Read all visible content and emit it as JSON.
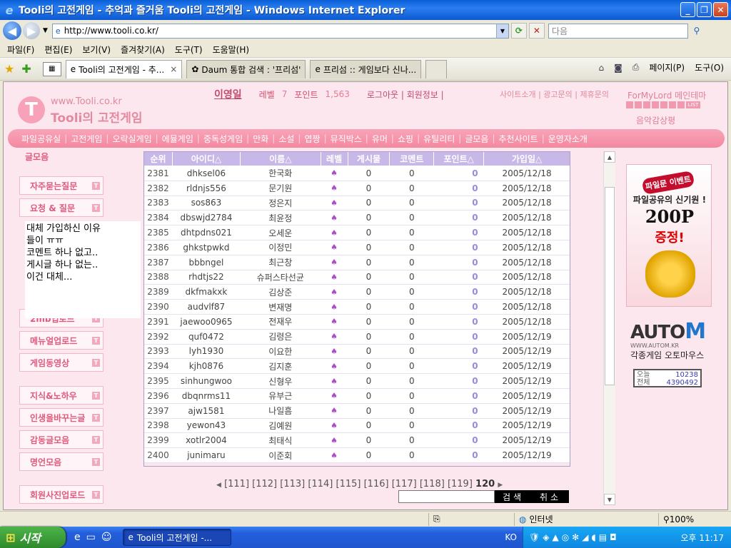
{
  "window": {
    "title": "Tooli의 고전게임 - 추억과 즐거움 Tooli의 고전게임 - Windows Internet Explorer"
  },
  "address": {
    "url": "http://www.tooli.co.kr/",
    "search_placeholder": "다음"
  },
  "menu": [
    "파일(F)",
    "편집(E)",
    "보기(V)",
    "즐겨찾기(A)",
    "도구(T)",
    "도움말(H)"
  ],
  "tabs": [
    {
      "label": "Tooli의 고전게임 - 추...",
      "close": "×"
    },
    {
      "label": "Daum 통합 검색 : '프리섬'"
    },
    {
      "label": "프리섬 :: 게임보다 신나..."
    }
  ],
  "commands": {
    "page": "페이지(P)",
    "tools": "도구(O)"
  },
  "site": {
    "logo_url": "www.Tooli.co.kr",
    "logo_name": "Tooli의 고전게임",
    "user": {
      "name": "이영일",
      "level_label": "레벨",
      "level": "7",
      "point_label": "포인트",
      "points": "1,563",
      "links": "로그아웃 | 회원정보 |"
    },
    "top_links": "사이트소개 | 광고문의 | 제휴문의",
    "theme": "ForMyLord 메인테마",
    "theme_list": "LIST",
    "music": "음악감상평",
    "nav": [
      "파일공유실",
      "고전게임",
      "오락실게임",
      "에뮬게임",
      "중독성게임",
      "만화",
      "소설",
      "엽짱",
      "뮤직박스",
      "유머",
      "쇼핑",
      "유틸리티",
      "글모음",
      "추천사이트",
      "운영자소개"
    ],
    "left_head": "글모음",
    "left_menu": [
      "자주묻는질문",
      "요청 & 질문",
      "2mb업로드",
      "메뉴얼업로드",
      "게임동영상",
      "지식&노하우",
      "인생을바꾸는글",
      "감동글모음",
      "명언모음",
      "회원사진업로드"
    ],
    "note": [
      "대체 가입하신 이유",
      "들이 ㅠㅠ",
      "코멘트 하나 없고..",
      "게시글 하나 없는..",
      "이건 대체..."
    ],
    "table": {
      "headers": [
        "순위",
        "아이디△",
        "이름△",
        "레벨",
        "게시물",
        "코멘트",
        "포인트△",
        "가입일△"
      ],
      "rows": [
        [
          "2381",
          "dhksel06",
          "한국화",
          "0",
          "0",
          "0",
          "2005/12/18"
        ],
        [
          "2382",
          "rldnjs556",
          "문기원",
          "0",
          "0",
          "0",
          "2005/12/18"
        ],
        [
          "2383",
          "sos863",
          "정은지",
          "0",
          "0",
          "0",
          "2005/12/18"
        ],
        [
          "2384",
          "dbswjd2784",
          "최윤정",
          "0",
          "0",
          "0",
          "2005/12/18"
        ],
        [
          "2385",
          "dhtpdns021",
          "오세운",
          "0",
          "0",
          "0",
          "2005/12/18"
        ],
        [
          "2386",
          "ghkstpwkd",
          "이정민",
          "0",
          "0",
          "0",
          "2005/12/18"
        ],
        [
          "2387",
          "bbbngel",
          "최근창",
          "0",
          "0",
          "0",
          "2005/12/18"
        ],
        [
          "2388",
          "rhdtjs22",
          "슈퍼스타선균",
          "0",
          "0",
          "0",
          "2005/12/18"
        ],
        [
          "2389",
          "dkfmakxk",
          "김상준",
          "0",
          "0",
          "0",
          "2005/12/18"
        ],
        [
          "2390",
          "audvlf87",
          "변재명",
          "0",
          "0",
          "0",
          "2005/12/18"
        ],
        [
          "2391",
          "jaewoo0965",
          "전재우",
          "0",
          "0",
          "0",
          "2005/12/18"
        ],
        [
          "2392",
          "quf0472",
          "김령은",
          "0",
          "0",
          "0",
          "2005/12/19"
        ],
        [
          "2393",
          "lyh1930",
          "이요한",
          "0",
          "0",
          "0",
          "2005/12/19"
        ],
        [
          "2394",
          "kjh0876",
          "김지훈",
          "0",
          "0",
          "0",
          "2005/12/19"
        ],
        [
          "2395",
          "sinhungwoo",
          "신형우",
          "0",
          "0",
          "0",
          "2005/12/19"
        ],
        [
          "2396",
          "dbqnrms11",
          "유부근",
          "0",
          "0",
          "0",
          "2005/12/19"
        ],
        [
          "2397",
          "ajw1581",
          "나일흠",
          "0",
          "0",
          "0",
          "2005/12/19"
        ],
        [
          "2398",
          "yewon43",
          "김예원",
          "0",
          "0",
          "0",
          "2005/12/19"
        ],
        [
          "2399",
          "xotlr2004",
          "최태식",
          "0",
          "0",
          "0",
          "2005/12/19"
        ],
        [
          "2400",
          "junimaru",
          "이준회",
          "0",
          "0",
          "0",
          "2005/12/19"
        ]
      ]
    },
    "pager": {
      "pages": [
        "[111]",
        "[112]",
        "[113]",
        "[114]",
        "[115]",
        "[116]",
        "[117]",
        "[118]",
        "[119]"
      ],
      "current": "120"
    },
    "search_btn": "검색",
    "cancel_btn": "취소",
    "banner": {
      "tag": "파일문 이벤트",
      "line1": "파일공유의 신기원 !",
      "big": "200P",
      "sub": "증정!"
    },
    "autom": {
      "brand": "AUTO",
      "brand_m": "M",
      "www": "WWW.AUTOM.KR",
      "desc": "각종게임 오토마우스"
    },
    "counter": {
      "today_label": "오늘",
      "today": "10238",
      "total_label": "전체",
      "total": "4390492"
    }
  },
  "status": {
    "zone": "인터넷",
    "zoom": "100%"
  },
  "taskbar": {
    "start": "시작",
    "task": "Tooli의 고전게임 -...",
    "lang": "KO",
    "clock": "오후 11:17"
  }
}
